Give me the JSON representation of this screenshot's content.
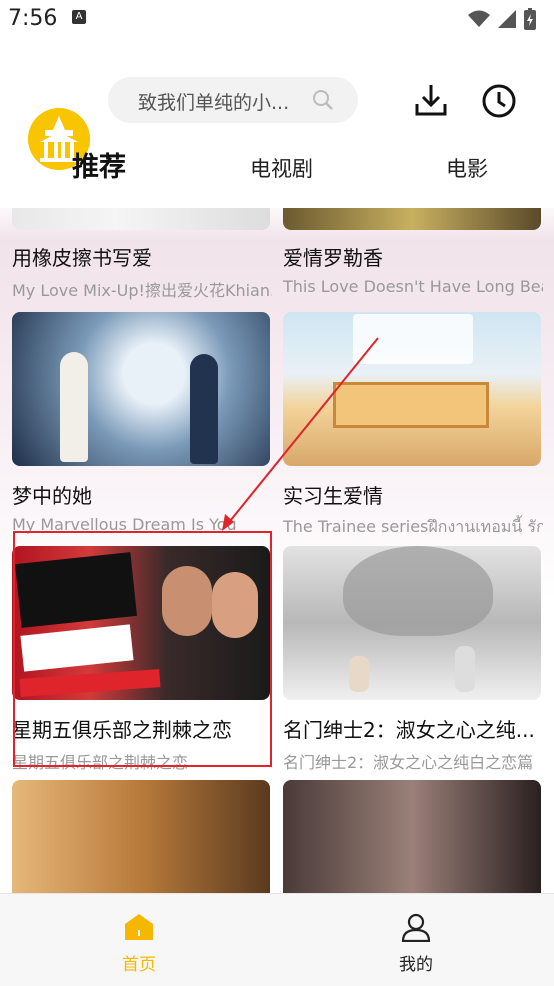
{
  "status": {
    "time": "7:56",
    "notif": "A"
  },
  "search": {
    "placeholder": "致我们单纯的小..."
  },
  "tabs": [
    {
      "label": "推荐",
      "active": true
    },
    {
      "label": "电视剧",
      "active": false
    },
    {
      "label": "电影",
      "active": false
    }
  ],
  "cards": [
    {
      "title": "用橡皮擦书写爱",
      "subtitle": "My Love Mix-Up!擦出爱火花Khian..."
    },
    {
      "title": "爱情罗勒香",
      "subtitle": "This Love Doesn't Have Long Bean..."
    },
    {
      "title": "梦中的她",
      "subtitle": "My Marvellous Dream Is You"
    },
    {
      "title": "实习生爱情",
      "subtitle": "The Trainee seriesฝึกงานเทอมนี้ รัก..."
    },
    {
      "title": "星期五俱乐部之荆棘之恋",
      "subtitle": "星期五俱乐部之荆棘之恋"
    },
    {
      "title": "名门绅士2：淑女之心之纯...",
      "subtitle": "名门绅士2：淑女之心之纯白之恋篇"
    },
    {
      "title": "",
      "subtitle": ""
    },
    {
      "title": "",
      "subtitle": ""
    }
  ],
  "bottom_nav": [
    {
      "label": "首页",
      "active": true
    },
    {
      "label": "我的",
      "active": false
    }
  ],
  "colors": {
    "accent": "#f5b700",
    "highlight": "#e0242b"
  }
}
